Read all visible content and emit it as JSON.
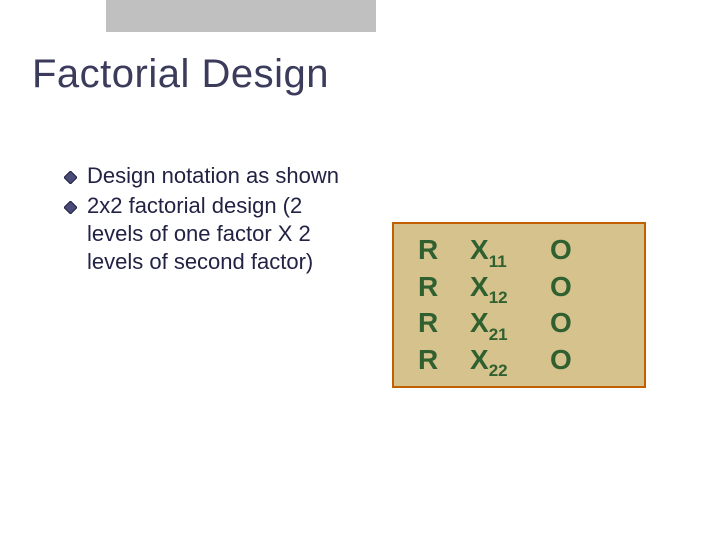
{
  "decor": {
    "top_bar_color": "#c0c0c0"
  },
  "title": "Factorial Design",
  "bullets": [
    {
      "text": "Design notation as shown"
    },
    {
      "text": "2x2 factorial design (2 levels of one factor X 2 levels of second factor)"
    }
  ],
  "notation": {
    "rows": [
      {
        "r": "R",
        "x": "X",
        "sub": "11",
        "o": "O"
      },
      {
        "r": "R",
        "x": "X",
        "sub": "12",
        "o": "O"
      },
      {
        "r": "R",
        "x": "X",
        "sub": "21",
        "o": "O"
      },
      {
        "r": "R",
        "x": "X",
        "sub": "22",
        "o": "O"
      }
    ]
  }
}
